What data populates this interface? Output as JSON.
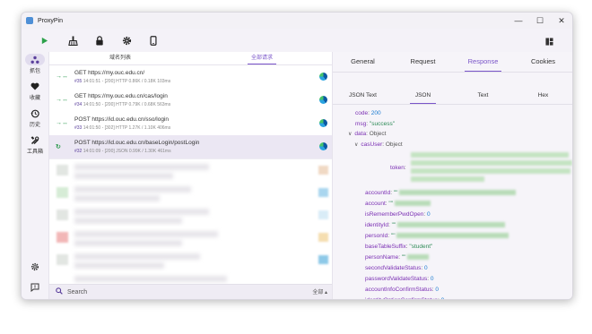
{
  "window": {
    "title": "ProxyPin",
    "controls": [
      "—",
      "☐",
      "✕"
    ]
  },
  "toolbar": {
    "icons": [
      "play-icon",
      "broom-icon",
      "lock-icon",
      "gear-icon",
      "phone-icon"
    ],
    "right_icon": "layout-icon"
  },
  "sidebar": {
    "items": [
      {
        "label": "抓包",
        "icon": "network-icon"
      },
      {
        "label": "收藏",
        "icon": "heart-icon"
      },
      {
        "label": "历史",
        "icon": "history-icon"
      },
      {
        "label": "工具箱",
        "icon": "tools-icon"
      }
    ]
  },
  "request_panel": {
    "tabs": [
      "域名列表",
      "全部请求"
    ],
    "active_tab": "全部请求",
    "rows": [
      {
        "method": "GET",
        "url": "https://my.ouc.edu.cn/",
        "id": "#35",
        "meta": " 14:01:51 - [200]  HTTP 0.86K / 0.18K  103ms",
        "lead": "→↔"
      },
      {
        "method": "GET",
        "url": "https://my.ouc.edu.cn/cas/login",
        "id": "#34",
        "meta": " 14:01:50 - [200]  HTTP 0.79K / 0.68K  563ms",
        "lead": "→↔"
      },
      {
        "method": "POST",
        "url": "https://id.ouc.edu.cn/sso/login",
        "id": "#33",
        "meta": " 14:01:50 - [302]  HTTP 1.27K / 1.10K  406ms",
        "lead": "→↔"
      },
      {
        "method": "POST",
        "url": "https://id.ouc.edu.cn/baseLogin/postLogin",
        "id": "#32",
        "meta": " 14:01:09 - [200]  JSON 0.99K / 1.30K  461ms",
        "lead": "↻"
      }
    ],
    "search": {
      "placeholder": "Search",
      "filter": "全部 ▴"
    }
  },
  "response_panel": {
    "tabs": [
      "General",
      "Request",
      "Response",
      "Cookies"
    ],
    "active_tab": "Response",
    "sub_tabs": [
      "JSON Text",
      "JSON",
      "Text",
      "Hex"
    ],
    "active_sub_tab": "JSON",
    "json": {
      "code_key": "code",
      "code_val": "200",
      "msg_key": "msg",
      "msg_val": "\"success\"",
      "data_key": "data",
      "data_type": "Object",
      "casuser_key": "casUser",
      "casuser_type": "Object",
      "token_key": "token",
      "fields": [
        {
          "key": "accountId",
          "val": "\"\""
        },
        {
          "key": "account",
          "val": "\"\""
        },
        {
          "key": "isRememberPwdOpen",
          "val": "0"
        },
        {
          "key": "identityId",
          "val": "\"\""
        },
        {
          "key": "personId",
          "val": "\"\""
        },
        {
          "key": "baseTableSuffix",
          "val": "\"student\""
        },
        {
          "key": "personName",
          "val": "\"\""
        },
        {
          "key": "secondValidateStatus",
          "val": "0"
        },
        {
          "key": "passwordValidateStatus",
          "val": "0"
        },
        {
          "key": "accountInfoConfirmStatus",
          "val": "0"
        },
        {
          "key": "identityOptionConfirmStatus",
          "val": "0"
        },
        {
          "key": "email",
          "val": "\"\""
        }
      ]
    }
  }
}
